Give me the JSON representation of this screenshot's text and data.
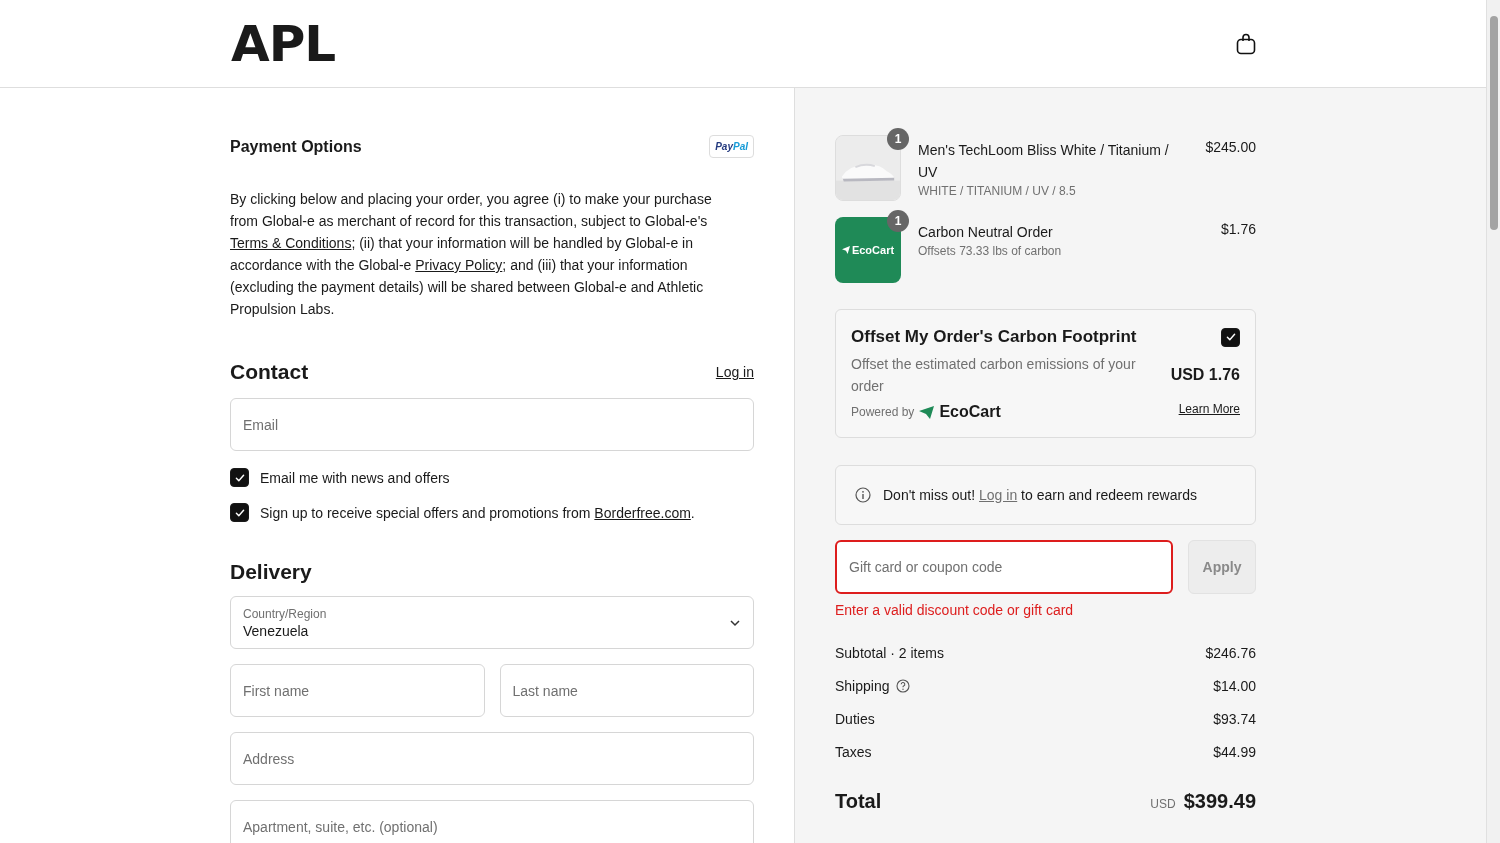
{
  "header": {
    "logo": "APL"
  },
  "payment": {
    "title": "Payment Options",
    "paypal": [
      "Pay",
      "Pal"
    ],
    "disclaimer": {
      "texts": [
        "By clicking below and placing your order, you agree (i) to make your purchase from Global-e as merchant of record for this transaction, subject to Global-e's ",
        "; (ii) that your information will be handled by Global-e in accordance with the Global-e ",
        "; and (iii) that your information (excluding the payment details) will be shared between Global-e and Athletic Propulsion Labs."
      ],
      "links": [
        "Terms & Conditions",
        "Privacy Policy"
      ]
    }
  },
  "contact": {
    "title": "Contact",
    "login": "Log in",
    "email": {
      "placeholder": "Email"
    },
    "checkboxes": [
      {
        "checked": true,
        "texts": [
          "Email me with news and offers"
        ]
      },
      {
        "checked": true,
        "texts": [
          "Sign up to receive special offers and promotions from ",
          "."
        ],
        "links": [
          "Borderfree.com"
        ]
      }
    ]
  },
  "delivery": {
    "title": "Delivery",
    "country": {
      "label": "Country/Region",
      "value": "Venezuela"
    },
    "rows": [
      [
        {
          "placeholder": "First name"
        },
        {
          "placeholder": "Last name"
        }
      ],
      [
        {
          "placeholder": "Address"
        }
      ],
      [
        {
          "placeholder": "Apartment, suite, etc. (optional)"
        }
      ]
    ]
  },
  "items": [
    {
      "kind": "picture",
      "quantity": "1",
      "name": "Men's TechLoom Bliss White / Titanium / UV",
      "detail": "WHITE / TITANIUM / UV / 8.5",
      "price": "$245.00"
    },
    {
      "kind": "ecocart",
      "thumb_label": "EcoCart",
      "quantity": "1",
      "name": "Carbon Neutral Order",
      "detail": "Offsets 73.33 lbs of carbon",
      "price": "$1.76"
    }
  ],
  "offset": {
    "title": "Offset My Order's Carbon Footprint",
    "checked": true,
    "description": "Offset the estimated carbon emissions of your order",
    "price": "USD 1.76",
    "powered_by": "Powered by",
    "brand": "EcoCart",
    "learn_more": "Learn More"
  },
  "rewards": {
    "before": "Don't miss out! ",
    "link": "Log in",
    "after": " to earn and redeem rewards"
  },
  "coupon": {
    "placeholder": "Gift card or coupon code",
    "invalid": true,
    "button": "Apply",
    "disabled": true,
    "error": "Enter a valid discount code or gift card"
  },
  "summary": [
    {
      "label": "Subtotal · 2 items",
      "value": "$246.76",
      "info": false
    },
    {
      "label": "Shipping",
      "value": "$14.00",
      "info": true
    },
    {
      "label": "Duties",
      "value": "$93.74",
      "info": false
    },
    {
      "label": "Taxes",
      "value": "$44.99",
      "info": false
    }
  ],
  "total": {
    "label": "Total",
    "currency": "USD",
    "value": "$399.49"
  }
}
